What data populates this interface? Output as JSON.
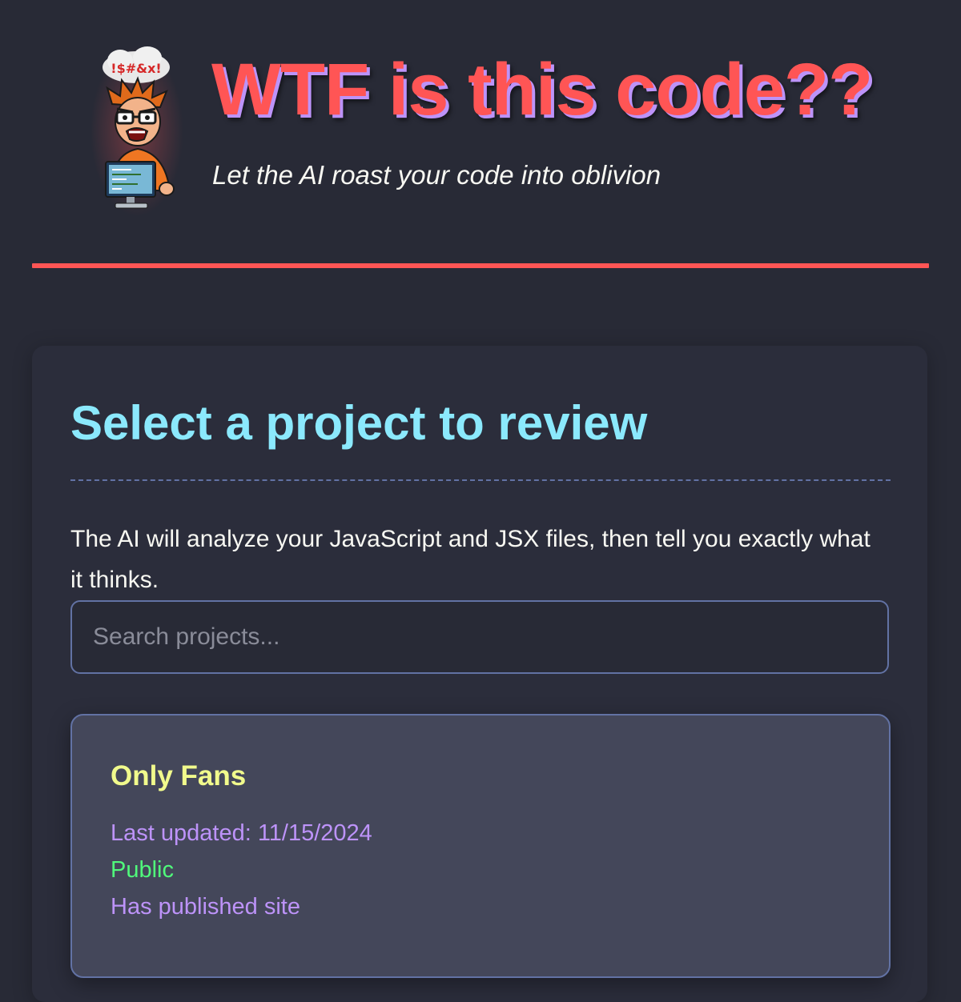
{
  "header": {
    "title": "WTF is this code??",
    "subtitle": "Let the AI roast your code into oblivion",
    "logo_icon": "angry-coder-avatar-icon",
    "logo_symbols": "!$#&x!"
  },
  "colors": {
    "background": "#282a36",
    "accent_red": "#ff5555",
    "title_shadow": "#bd93f9",
    "heading_cyan": "#8be9fd",
    "project_name_yellow": "#f1fa8c",
    "meta_purple": "#bd93f9",
    "public_green": "#50fa7b",
    "card": "#44475a"
  },
  "main": {
    "section_title": "Select a project to review",
    "description": "The AI will analyze your JavaScript and JSX files, then tell you exactly what it thinks.",
    "search": {
      "placeholder": "Search projects...",
      "value": ""
    },
    "projects": [
      {
        "name": "Only Fans",
        "last_updated": "Last updated: 11/15/2024",
        "visibility": "Public",
        "published": "Has published site"
      }
    ]
  }
}
